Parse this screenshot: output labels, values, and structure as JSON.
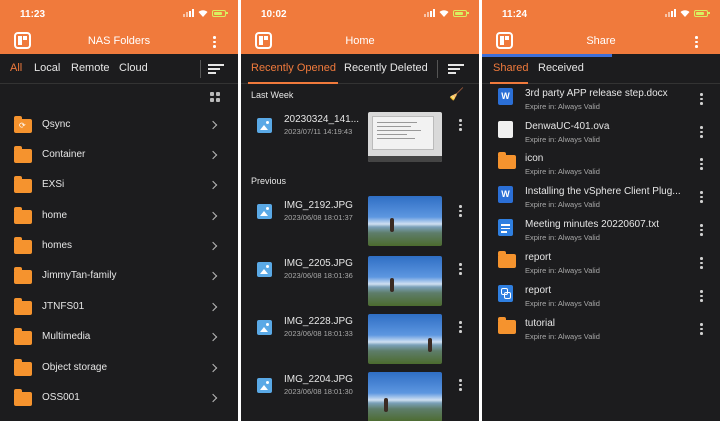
{
  "colors": {
    "accent": "#f07a3c",
    "share_tab_underline": "#3d6fd8",
    "background": "#1c1c1e",
    "folder": "#f5932e"
  },
  "panel1": {
    "status_time": "11:23",
    "title": "NAS Folders",
    "tabs": [
      "All",
      "Local",
      "Remote",
      "Cloud"
    ],
    "folders": [
      "Qsync",
      "Container",
      "EXSi",
      "home",
      "homes",
      "JimmyTan-family",
      "JTNFS01",
      "Multimedia",
      "Object storage",
      "OSS001"
    ]
  },
  "panel2": {
    "status_time": "10:02",
    "title": "Home",
    "tabs": [
      "Recently Opened",
      "Recently Deleted"
    ],
    "sections": {
      "last_week": "Last Week",
      "previous": "Previous"
    },
    "items": [
      {
        "name": "20230324_141...",
        "date": "2023/07/11 14:19:43"
      },
      {
        "name": "IMG_2192.JPG",
        "date": "2023/06/08 18:01:37"
      },
      {
        "name": "IMG_2205.JPG",
        "date": "2023/06/08 18:01:36"
      },
      {
        "name": "IMG_2228.JPG",
        "date": "2023/06/08 18:01:33"
      },
      {
        "name": "IMG_2204.JPG",
        "date": "2023/06/08 18:01:30"
      }
    ]
  },
  "panel3": {
    "status_time": "11:24",
    "title": "Share",
    "tabs": [
      "Shared",
      "Received"
    ],
    "expire_label": "Expire in: Always Valid",
    "items": [
      {
        "name": "3rd party APP release step.docx",
        "icon": "word-icon"
      },
      {
        "name": "DenwaUC-401.ova",
        "icon": "file-icon"
      },
      {
        "name": "icon",
        "icon": "folder-icon"
      },
      {
        "name": "Installing the vSphere Client Plug...",
        "icon": "word-icon"
      },
      {
        "name": "Meeting minutes 20220607.txt",
        "icon": "text-file-icon"
      },
      {
        "name": "report",
        "icon": "folder-icon"
      },
      {
        "name": "report",
        "icon": "link-icon"
      },
      {
        "name": "tutorial",
        "icon": "folder-icon"
      }
    ]
  }
}
